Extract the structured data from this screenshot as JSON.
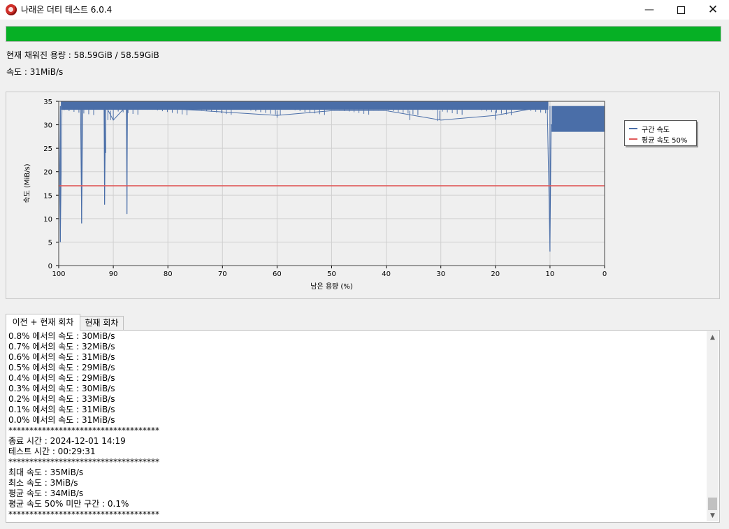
{
  "window": {
    "title": "나래온 더티 테스트 6.0.4",
    "minimize_icon": "minimize-icon",
    "maximize_icon": "maximize-icon",
    "close_icon": "close-icon",
    "app_icon": "app-logo-icon"
  },
  "progress": {
    "percent": 100,
    "color": "#06b025"
  },
  "info": {
    "capacity_text": "현재 채워진 용량 : 58.59GiB / 58.59GiB",
    "speed_text": "속도 : 31MiB/s"
  },
  "chart_data": {
    "type": "line",
    "xlabel": "남은 용량 (%)",
    "ylabel": "속도 (MiB/s)",
    "xlim": [
      100,
      0
    ],
    "ylim": [
      0,
      35
    ],
    "x_ticks": [
      100,
      90,
      80,
      70,
      60,
      50,
      40,
      30,
      20,
      10,
      0
    ],
    "y_ticks": [
      0,
      5,
      10,
      15,
      20,
      25,
      30,
      35
    ],
    "grid": true,
    "legend_position": "right",
    "series": [
      {
        "name": "구간 속도",
        "color": "#4a6ea8",
        "points": [
          [
            100,
            34
          ],
          [
            99.7,
            5
          ],
          [
            99.4,
            34
          ],
          [
            96,
            34
          ],
          [
            95.8,
            9
          ],
          [
            95.6,
            34
          ],
          [
            91.7,
            34
          ],
          [
            91.6,
            13
          ],
          [
            91.5,
            24
          ],
          [
            91.4,
            34
          ],
          [
            90,
            31
          ],
          [
            87.6,
            34
          ],
          [
            87.5,
            11
          ],
          [
            87.4,
            34
          ],
          [
            60,
            32
          ],
          [
            50,
            33
          ],
          [
            40,
            33
          ],
          [
            30,
            31
          ],
          [
            20,
            32
          ],
          [
            10.5,
            34
          ],
          [
            10,
            3
          ],
          [
            9.8,
            30
          ],
          [
            5,
            29.5
          ],
          [
            0,
            31
          ]
        ]
      },
      {
        "name": "평균 속도 50%",
        "color": "#e05a5a",
        "points": [
          [
            100,
            17
          ],
          [
            0,
            17
          ]
        ]
      }
    ]
  },
  "tabs": [
    {
      "label": "이전 + 현재 회차",
      "active": true
    },
    {
      "label": "현재 회차",
      "active": false
    }
  ],
  "log": {
    "lines": [
      "0.8% 에서의 속도 : 30MiB/s",
      "0.7% 에서의 속도 : 32MiB/s",
      "0.6% 에서의 속도 : 31MiB/s",
      "0.5% 에서의 속도 : 29MiB/s",
      "0.4% 에서의 속도 : 29MiB/s",
      "0.3% 에서의 속도 : 30MiB/s",
      "0.2% 에서의 속도 : 33MiB/s",
      "0.1% 에서의 속도 : 31MiB/s",
      "0.0% 에서의 속도 : 31MiB/s",
      "************************************",
      "종료 시간 : 2024-12-01 14:19",
      "테스트 시간 : 00:29:31",
      "************************************",
      "최대 속도 : 35MiB/s",
      "최소 속도 : 3MiB/s",
      "평균 속도 : 34MiB/s",
      "평균 속도 50% 미만 구간 : 0.1%",
      "************************************"
    ],
    "scroll_up_icon": "scroll-up-icon",
    "scroll_down_icon": "scroll-down-icon"
  }
}
